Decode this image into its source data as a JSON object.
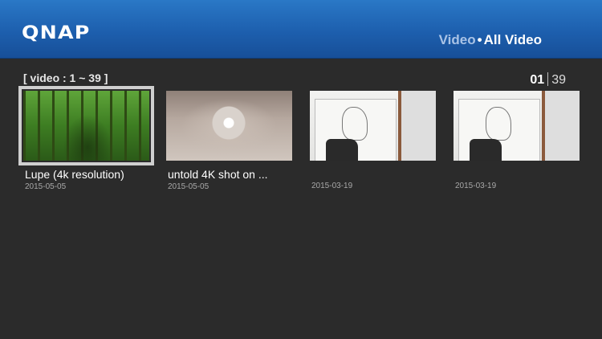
{
  "header": {
    "logo": "QNAP",
    "breadcrumb_section": "Video",
    "breadcrumb_sep": "•",
    "breadcrumb_page": "All Video"
  },
  "range_label": "[ video : 1 ~ 39 ]",
  "pager": {
    "current": "01",
    "total": "39"
  },
  "videos": [
    {
      "title": "Lupe  (4k resolution)",
      "date": "2015-05-05",
      "thumb_icon": "forest-video-thumbnail",
      "selected": true
    },
    {
      "title": "untold  4K shot on ...",
      "date": "2015-05-05",
      "thumb_icon": "chandelier-video-thumbnail",
      "selected": false
    },
    {
      "title": "",
      "date": "2015-03-19",
      "thumb_icon": "sketch-drawing-video-thumbnail",
      "selected": false
    },
    {
      "title": "",
      "date": "2015-03-19",
      "thumb_icon": "sketch-drawing-video-thumbnail",
      "selected": false
    }
  ],
  "colors": {
    "header_blue": "#1d5fae",
    "background": "#2b2b2b",
    "selection": "#cfcfcf"
  }
}
